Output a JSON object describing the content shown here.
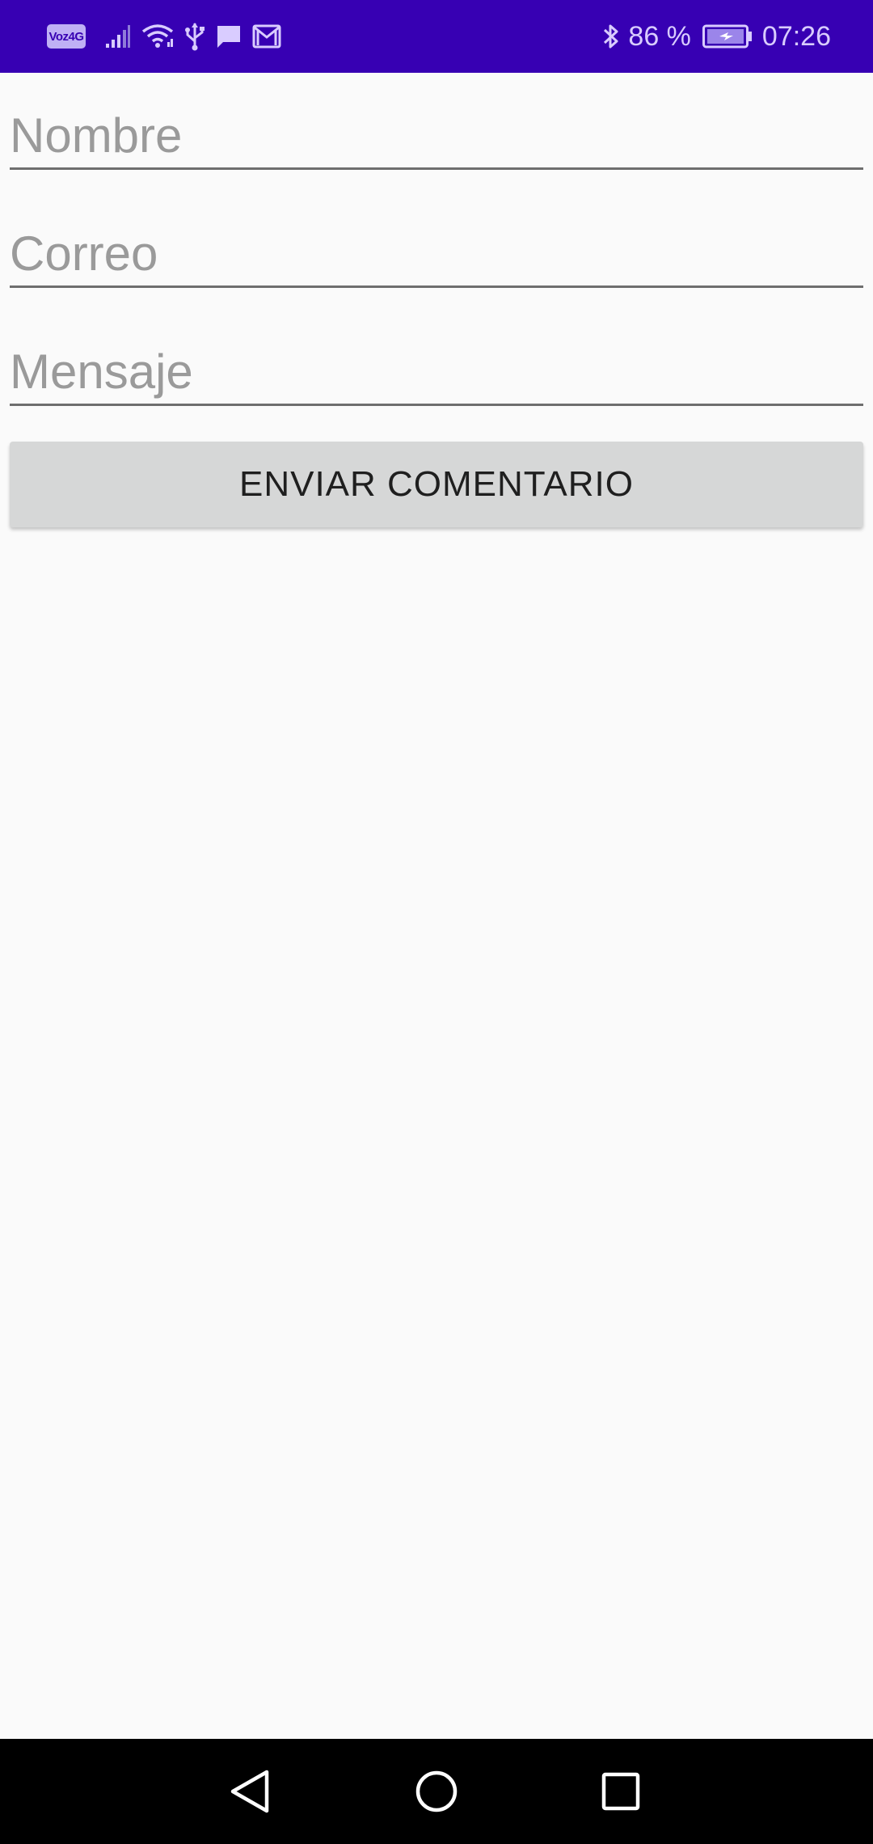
{
  "status_bar": {
    "volte_label": "Voz4G",
    "icons": [
      "signal-icon",
      "wifi-icon",
      "usb-icon",
      "message-icon",
      "gmail-icon"
    ],
    "right_icons": [
      "bluetooth-icon",
      "battery-charging-icon"
    ],
    "battery_percent": "86 %",
    "time": "07:26",
    "background_color": "#3700b3"
  },
  "form": {
    "name_placeholder": "Nombre",
    "name_value": "",
    "email_placeholder": "Correo",
    "email_value": "",
    "message_placeholder": "Mensaje",
    "message_value": "",
    "submit_label": "ENVIAR COMENTARIO"
  },
  "nav_bar": {
    "icons": [
      "back-icon",
      "home-icon",
      "recents-icon"
    ]
  }
}
